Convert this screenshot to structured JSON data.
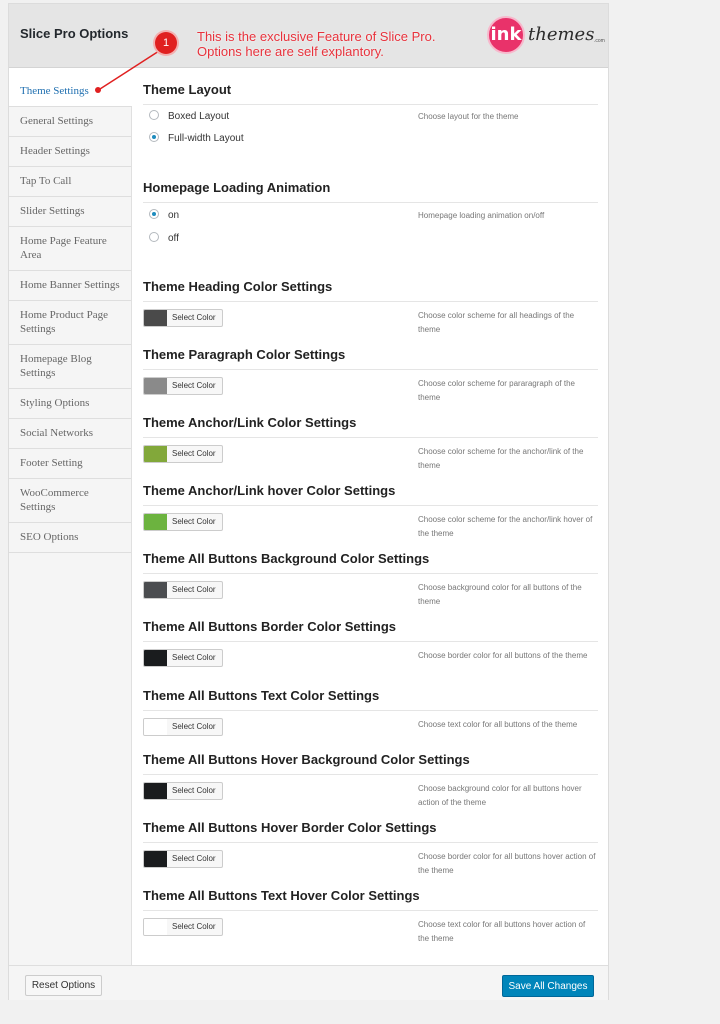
{
  "app": {
    "title": "Slice Pro Options"
  },
  "annotation": {
    "badge": "1",
    "text": "This is the exclusive Feature of Slice Pro. Options here are self explantory."
  },
  "logo": {
    "mark": "ink",
    "text": "themes",
    "suffix": ".com"
  },
  "sidebar": {
    "items": [
      {
        "label": "Theme Settings",
        "active": true
      },
      {
        "label": "General Settings"
      },
      {
        "label": "Header Settings"
      },
      {
        "label": "Tap To Call"
      },
      {
        "label": "Slider Settings"
      },
      {
        "label": "Home Page Feature Area"
      },
      {
        "label": "Home Banner Settings"
      },
      {
        "label": "Home Product Page Settings"
      },
      {
        "label": "Homepage Blog Settings"
      },
      {
        "label": "Styling Options"
      },
      {
        "label": "Social Networks"
      },
      {
        "label": "Footer Setting"
      },
      {
        "label": "WooCommerce Settings"
      },
      {
        "label": "SEO Options"
      }
    ]
  },
  "layout_section": {
    "title": "Theme Layout",
    "description": "Choose layout for the theme",
    "options": [
      {
        "label": "Boxed Layout",
        "checked": false
      },
      {
        "label": "Full-width Layout",
        "checked": true
      }
    ]
  },
  "animation_section": {
    "title": "Homepage Loading Animation",
    "description": "Homepage loading animation on/off",
    "options": [
      {
        "label": "on",
        "checked": true
      },
      {
        "label": "off",
        "checked": false
      }
    ]
  },
  "color_button_label": "Select Color",
  "color_sections": [
    {
      "title": "Theme Heading Color Settings",
      "description": "Choose color scheme for all headings of the theme",
      "color": "#4a4a4a"
    },
    {
      "title": "Theme Paragraph Color Settings",
      "description": "Choose color scheme for pararagraph of the theme",
      "color": "#8a8a8a"
    },
    {
      "title": "Theme Anchor/Link Color Settings",
      "description": "Choose color scheme for the anchor/link of the theme",
      "color": "#82a83a"
    },
    {
      "title": "Theme Anchor/Link hover Color Settings",
      "description": "Choose color scheme for the anchor/link hover of the theme",
      "color": "#6cb33f"
    },
    {
      "title": "Theme All Buttons Background Color Settings",
      "description": "Choose background color for all buttons of the theme",
      "color": "#4b4d50"
    },
    {
      "title": "Theme All Buttons Border Color Settings",
      "description": "Choose border color for all buttons of the theme",
      "color": "#1a1c1e"
    },
    {
      "title": "Theme All Buttons Text Color Settings",
      "description": "Choose text color for all buttons of the theme",
      "color": "#ffffff"
    },
    {
      "title": "Theme All Buttons Hover Background Color Settings",
      "description": "Choose background color for all buttons hover action of the theme",
      "color": "#1a1c1e"
    },
    {
      "title": "Theme All Buttons Hover Border Color Settings",
      "description": "Choose border color for all buttons hover action of the theme",
      "color": "#1a1c1e"
    },
    {
      "title": "Theme All Buttons Text Hover Color Settings",
      "description": "Choose text color for all buttons hover action of the theme",
      "color": "#ffffff"
    }
  ],
  "footer": {
    "reset_label": "Reset Options",
    "save_label": "Save All Changes"
  },
  "colors": {
    "accent": "#0085ba",
    "link": "#2271b1",
    "annotation": "#e02020"
  }
}
